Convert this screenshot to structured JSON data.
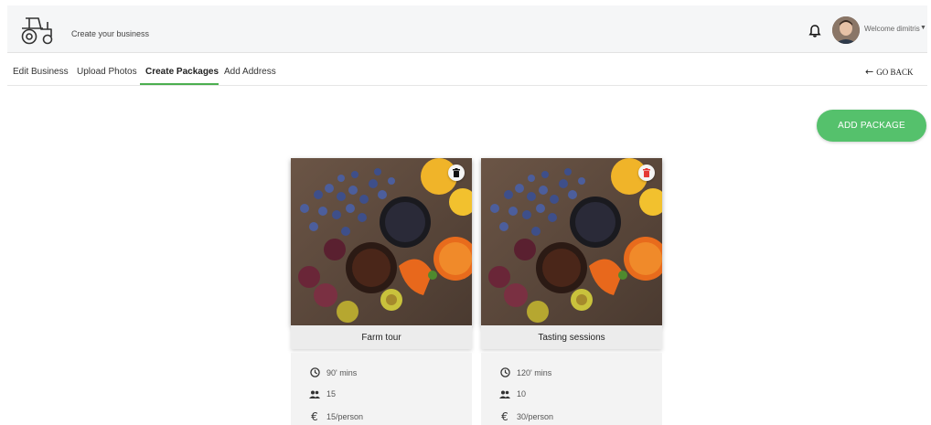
{
  "header": {
    "subtitle": "Create your business",
    "welcome": "Welcome dimitris",
    "logo_icon": "tractor-icon",
    "notification_icon": "bell-icon"
  },
  "tabs": [
    {
      "label": "Edit Business",
      "active": false
    },
    {
      "label": "Upload Photos",
      "active": false
    },
    {
      "label": "Create Packages",
      "active": true
    },
    {
      "label": "Add Address",
      "active": false
    }
  ],
  "go_back": "GO BACK",
  "add_package": "ADD PACKAGE",
  "colors": {
    "accent": "#4caf50",
    "button": "#55c16c",
    "delete_hover": "#e53935"
  },
  "packages": [
    {
      "title": "Farm tour",
      "duration": "90' mins",
      "people": "15",
      "price": "15/person"
    },
    {
      "title": "Tasting sessions",
      "duration": "120' mins",
      "people": "10",
      "price": "30/person"
    }
  ]
}
